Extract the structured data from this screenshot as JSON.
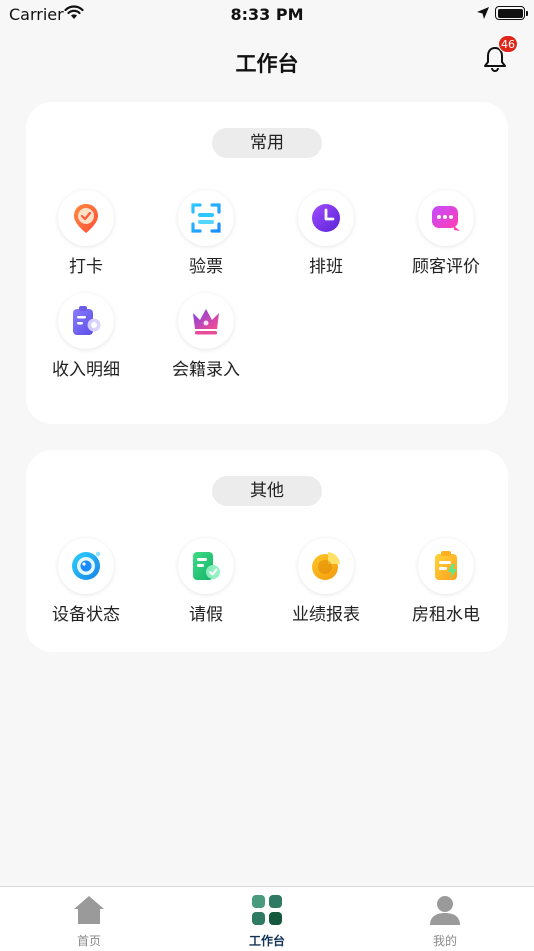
{
  "status_bar": {
    "carrier": "Carrier",
    "time": "8:33 PM"
  },
  "header": {
    "title": "工作台",
    "notification_count": "46"
  },
  "sections": {
    "common": {
      "title": "常用",
      "items": [
        {
          "label": "打卡",
          "icon": "location-check-icon"
        },
        {
          "label": "验票",
          "icon": "scan-icon"
        },
        {
          "label": "排班",
          "icon": "clock-icon"
        },
        {
          "label": "顾客评价",
          "icon": "chat-bubble-icon"
        },
        {
          "label": "收入明细",
          "icon": "clipboard-money-icon"
        },
        {
          "label": "会籍录入",
          "icon": "crown-icon"
        }
      ]
    },
    "other": {
      "title": "其他",
      "items": [
        {
          "label": "设备状态",
          "icon": "camera-icon"
        },
        {
          "label": "请假",
          "icon": "leave-document-icon"
        },
        {
          "label": "业绩报表",
          "icon": "pie-chart-icon"
        },
        {
          "label": "房租水电",
          "icon": "utility-bill-icon"
        }
      ]
    }
  },
  "tabbar": {
    "items": [
      {
        "label": "首页",
        "icon": "home-icon",
        "active": false
      },
      {
        "label": "工作台",
        "icon": "workbench-grid-icon",
        "active": true
      },
      {
        "label": "我的",
        "icon": "user-icon",
        "active": false
      }
    ]
  },
  "colors": {
    "active_tab": "#123456",
    "badge": "#e0261a",
    "accent_purple": "#7b3fe4"
  }
}
